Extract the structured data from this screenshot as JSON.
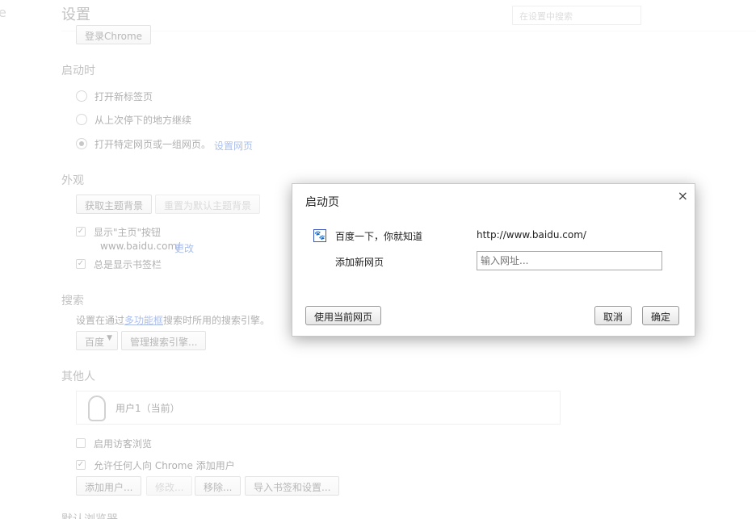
{
  "header": {
    "side_letter": "e",
    "title": "设置",
    "search_placeholder": "在设置中搜索"
  },
  "signin": {
    "button": "登录Chrome"
  },
  "startup": {
    "heading": "启动时",
    "options": [
      "打开新标签页",
      "从上次停下的地方继续",
      "打开特定网页或一组网页。"
    ],
    "set_pages_link": "设置网页"
  },
  "appearance": {
    "heading": "外观",
    "get_themes": "获取主题背景",
    "reset_theme": "重置为默认主题背景",
    "show_home": "显示\"主页\"按钮",
    "home_url": "www.baidu.com/",
    "change_link": "更改",
    "show_bookmarks": "总是显示书签栏"
  },
  "search": {
    "heading": "搜索",
    "desc_prefix": "设置在通过",
    "omnibox_link": "多功能框",
    "desc_suffix": "搜索时所用的搜索引擎。",
    "engine": "百度",
    "manage": "管理搜索引擎..."
  },
  "people": {
    "heading": "其他人",
    "user": "用户1（当前）",
    "guest": "启用访客浏览",
    "allow_add": "允许任何人向 Chrome 添加用户",
    "add_user": "添加用户...",
    "edit": "修改...",
    "remove": "移除...",
    "import": "导入书签和设置..."
  },
  "default_browser": {
    "heading": "默认浏览器"
  },
  "dialog": {
    "title": "启动页",
    "close": "×",
    "pages": [
      {
        "name": "百度一下，你就知道",
        "url": "http://www.baidu.com/"
      }
    ],
    "add_label": "添加新网页",
    "url_placeholder": "输入网址...",
    "use_current": "使用当前网页",
    "cancel": "取消",
    "ok": "确定"
  }
}
